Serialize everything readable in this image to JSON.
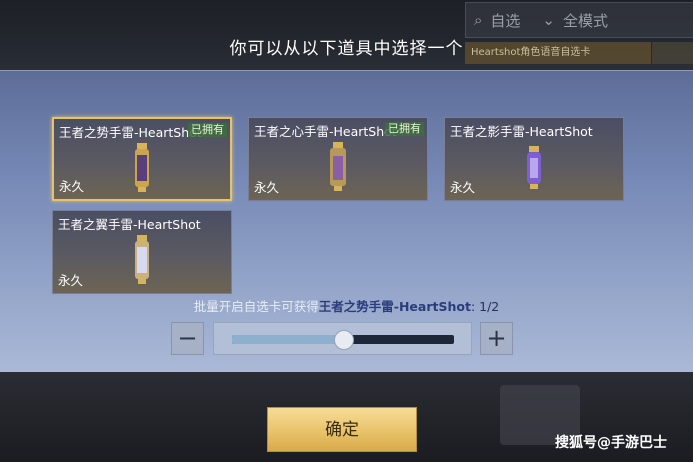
{
  "background": {
    "search_label": "自选",
    "mode_label": "全模式",
    "tag_label": "Heartshot角色语音自选卡"
  },
  "dialog": {
    "title": "你可以从以下道具中选择一个"
  },
  "items": [
    {
      "name": "王者之势手雷-HeartShot",
      "owned": "已拥有",
      "duration": "永久",
      "selected": true,
      "color": "#e6c26a"
    },
    {
      "name": "王者之心手雷-HeartShot",
      "owned": "已拥有",
      "duration": "永久",
      "selected": false,
      "color": "#b58ac9"
    },
    {
      "name": "王者之影手雷-HeartShot",
      "owned": "",
      "duration": "永久",
      "selected": false,
      "color": "#8a6bd6"
    },
    {
      "name": "王者之翼手雷-HeartShot",
      "owned": "",
      "duration": "永久",
      "selected": false,
      "color": "#c9cde6"
    }
  ],
  "batch_info": {
    "label": "批量开启自选卡可获得",
    "item": "王者之势手雷-HeartShot",
    "count": ": 1/2"
  },
  "slider": {
    "minus": "−",
    "plus": "+",
    "value": 0.5
  },
  "confirm_label": "确定",
  "watermark": "搜狐号@手游巴士"
}
